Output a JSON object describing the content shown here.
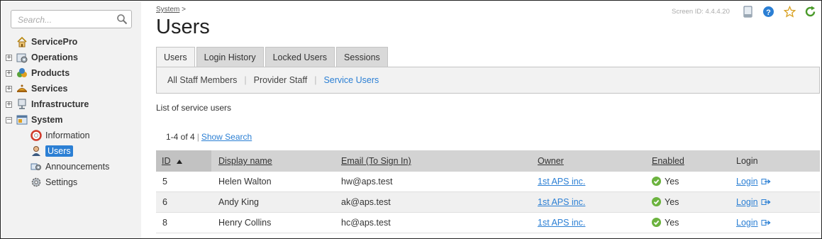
{
  "sidebar": {
    "search_placeholder": "Search...",
    "items": [
      {
        "label": "ServicePro"
      },
      {
        "label": "Operations"
      },
      {
        "label": "Products"
      },
      {
        "label": "Services"
      },
      {
        "label": "Infrastructure"
      },
      {
        "label": "System"
      },
      {
        "label": "Information"
      },
      {
        "label": "Users"
      },
      {
        "label": "Announcements"
      },
      {
        "label": "Settings"
      }
    ],
    "toggles": [
      "+",
      "+",
      "+",
      "+",
      "−"
    ]
  },
  "header": {
    "breadcrumb_link": "System",
    "breadcrumb_sep": ">",
    "title": "Users",
    "screen_id": "Screen ID: 4.4.4.20"
  },
  "tabs": [
    {
      "label": "Users",
      "active": true
    },
    {
      "label": "Login History"
    },
    {
      "label": "Locked Users"
    },
    {
      "label": "Sessions"
    }
  ],
  "subnav": [
    {
      "label": "All Staff Members"
    },
    {
      "label": "Provider Staff"
    },
    {
      "label": "Service Users",
      "active": true
    }
  ],
  "subnav_sep": "|",
  "list_description": "List of service users",
  "pager": {
    "range": "1-4 of 4",
    "sep": "|",
    "show_search": "Show Search"
  },
  "table": {
    "columns": {
      "id": "ID",
      "display_name": "Display name",
      "email": "Email (To Sign In)",
      "owner": "Owner",
      "enabled": "Enabled",
      "login": "Login"
    },
    "rows": [
      {
        "id": "5",
        "name": "Helen Walton",
        "email": "hw@aps.test",
        "owner": "1st APS inc.",
        "enabled": "Yes",
        "login": "Login"
      },
      {
        "id": "6",
        "name": "Andy King",
        "email": "ak@aps.test",
        "owner": "1st APS inc.",
        "enabled": "Yes",
        "login": "Login"
      },
      {
        "id": "8",
        "name": "Henry Collins",
        "email": "hc@aps.test",
        "owner": "1st APS inc.",
        "enabled": "Yes",
        "login": "Login"
      }
    ]
  },
  "colors": {
    "accent": "#2b7fd4",
    "enabled_green": "#6cb33f",
    "sidebar_bg": "#f2f2f2",
    "header_bg": "#d3d3d3"
  }
}
